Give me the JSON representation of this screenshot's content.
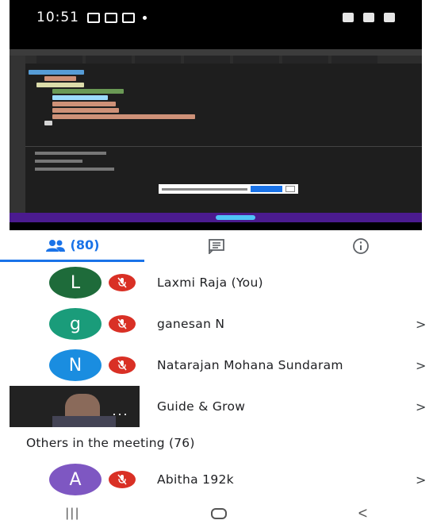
{
  "status_bar": {
    "time": "10:51",
    "icons": [
      "screen-record-icon",
      "gallery-icon",
      "message-icon",
      "wifi-icon",
      "signal-icon",
      "battery-icon"
    ]
  },
  "shared_screen": {
    "description_icon": "presentation"
  },
  "tabs": [
    {
      "icon": "people-icon",
      "label": "(80)",
      "active": true
    },
    {
      "icon": "chat-icon",
      "label": "",
      "active": false
    },
    {
      "icon": "info-icon",
      "label": "",
      "active": false
    }
  ],
  "participants": [
    {
      "initial": "L",
      "name": "Laxmi Raja (You)",
      "color": "#1e6b3a",
      "muted": true,
      "chevron": false
    },
    {
      "initial": "g",
      "name": "ganesan N",
      "color": "#1a9c7a",
      "muted": true,
      "chevron": true
    },
    {
      "initial": "N",
      "name": "Natarajan Mohana Sundaram",
      "color": "#1a8de0",
      "muted": true,
      "chevron": true
    },
    {
      "initial": "",
      "name": "Guide & Grow",
      "color": "#222222",
      "muted": false,
      "chevron": true,
      "video": true
    }
  ],
  "others_title": "Others in the meeting (76)",
  "others": [
    {
      "initial": "A",
      "name": "Abitha 192k",
      "color": "#7e57c2",
      "muted": true,
      "chevron": true
    }
  ],
  "chevron_symbol": ">",
  "video_more": "···",
  "colors": {
    "accent": "#1a73e8",
    "mute_red": "#d93025"
  }
}
